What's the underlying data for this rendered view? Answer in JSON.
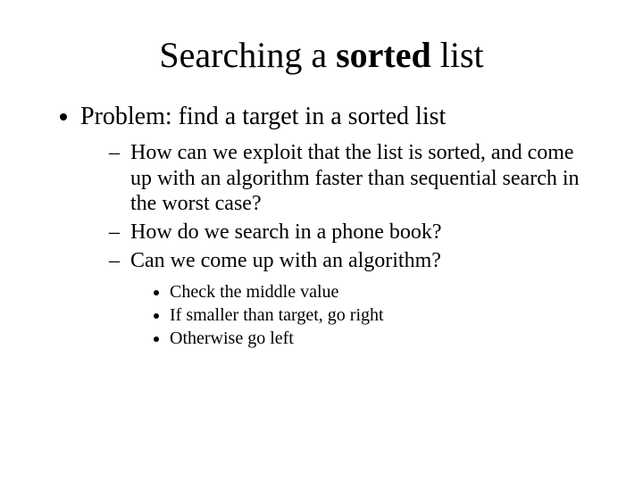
{
  "title_plain": "Searching a ",
  "title_bold": "sorted",
  "title_tail": " list",
  "l1_item0": "Problem: find a target in a sorted list",
  "l2_item0": "How can we exploit that the list is sorted, and come up with an algorithm faster than sequential search in the worst case?",
  "l2_item1": "How do we search in a phone book?",
  "l2_item2": "Can we come up with an algorithm?",
  "l3_item0": "Check the middle value",
  "l3_item1": "If smaller than target, go right",
  "l3_item2": "Otherwise go left"
}
